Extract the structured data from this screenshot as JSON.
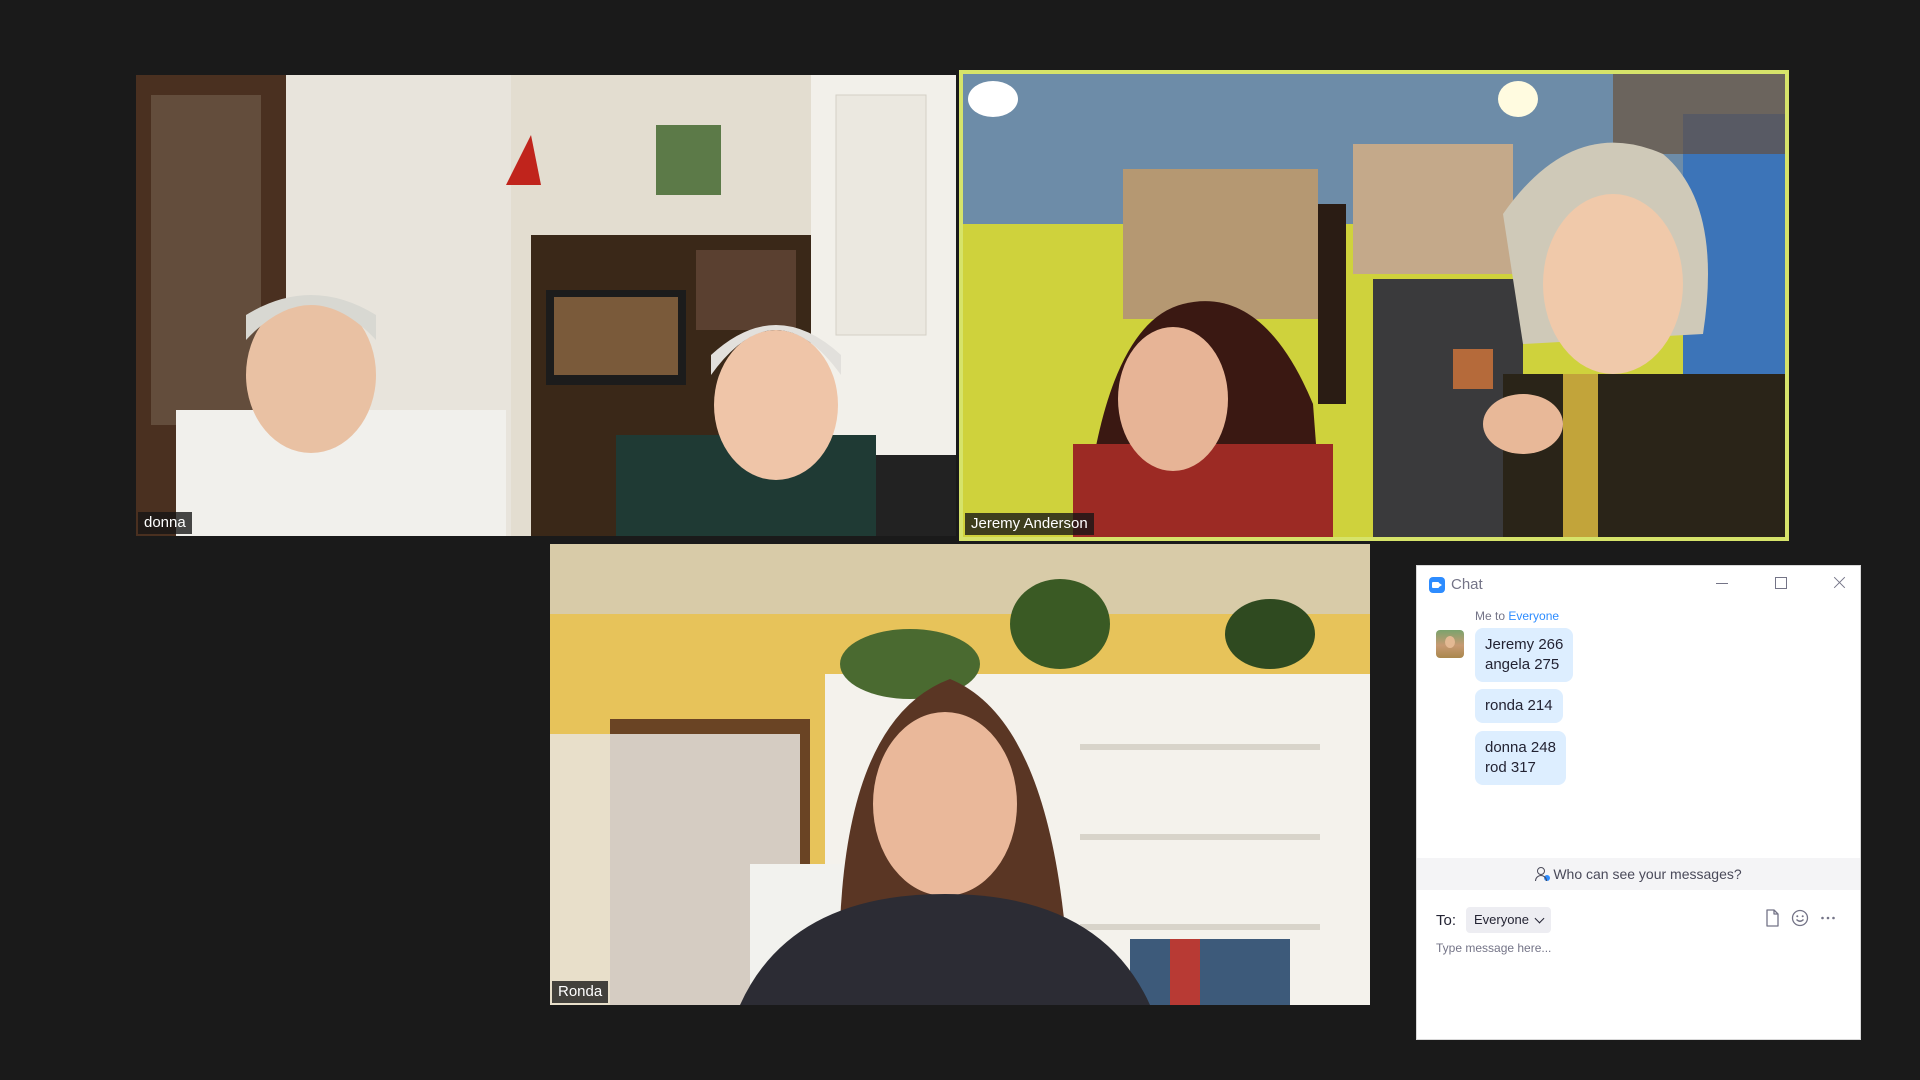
{
  "participants": [
    {
      "id": "donna",
      "name": "donna",
      "active_speaker": false
    },
    {
      "id": "jeremy",
      "name": "Jeremy Anderson",
      "active_speaker": true
    },
    {
      "id": "ronda",
      "name": "Ronda",
      "active_speaker": false
    }
  ],
  "colors": {
    "background": "#1a1a1a",
    "active_speaker_border": "#d6e36a",
    "accent_blue": "#2d8cff",
    "bubble": "#ddeeff"
  },
  "chat": {
    "title": "Chat",
    "message_header": {
      "prefix": "Me to",
      "target": "Everyone"
    },
    "messages": [
      {
        "lines": [
          "Jeremy 266",
          "angela 275"
        ]
      },
      {
        "lines": [
          "ronda 214"
        ]
      },
      {
        "lines": [
          "donna 248",
          "rod 317"
        ]
      }
    ],
    "privacy_prompt": "Who can see your messages?",
    "to_label": "To:",
    "recipient": "Everyone",
    "input_placeholder": "Type message here...",
    "icons": [
      "zoom-logo-icon",
      "minimize-icon",
      "maximize-icon",
      "close-icon",
      "person-info-icon",
      "chevron-down-icon",
      "file-icon",
      "emoji-icon",
      "more-icon"
    ]
  }
}
